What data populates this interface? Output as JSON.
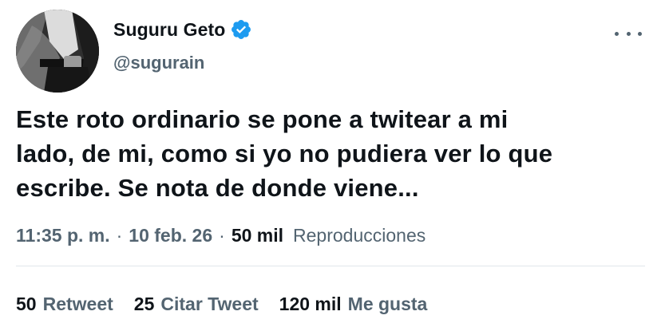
{
  "tweet": {
    "display_name": "Suguru Geto",
    "handle": "@sugurain",
    "verified": true,
    "text": "Este roto ordinario se pone a twitear a mi\nlado, de mi, como si yo no pudiera ver lo que\nescribe. Se nota de donde viene...",
    "time": "11:35 p. m.",
    "date": "10 feb. 26",
    "views_count": "50 mil",
    "views_label": "Reproducciones",
    "separator": "·",
    "stats": {
      "retweets_count": "50",
      "retweets_label": "Retweet",
      "quotes_count": "25",
      "quotes_label": "Citar Tweet",
      "likes_count": "120 mil",
      "likes_label": "Me gusta"
    }
  },
  "icons": {
    "verified": "verified-badge-icon",
    "more": "more-options-icon"
  },
  "colors": {
    "text_primary": "#0f1419",
    "text_secondary": "#536471",
    "verified_blue": "#1d9bf0",
    "divider": "#e1e6ea"
  }
}
